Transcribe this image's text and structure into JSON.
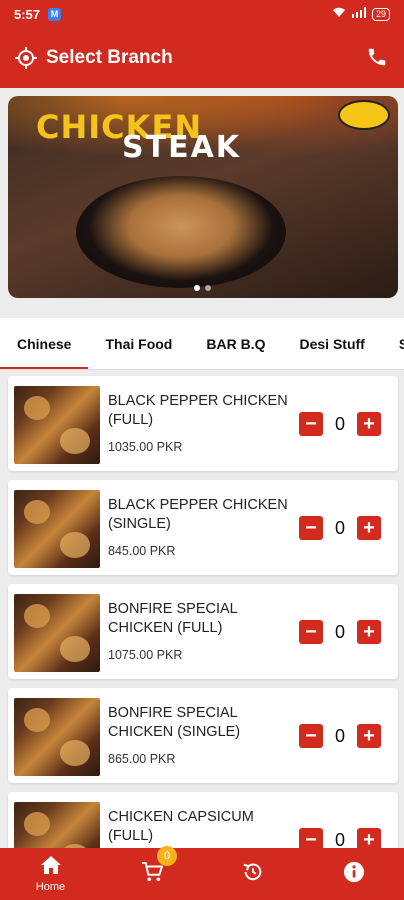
{
  "status_bar": {
    "time": "5:57",
    "notification": "M",
    "battery": "29"
  },
  "app_bar": {
    "title": "Select Branch",
    "location_icon": "location-target-icon",
    "phone_icon": "phone-icon"
  },
  "banner": {
    "line1": "CHICKEN",
    "line2": "STEAK"
  },
  "tabs": [
    {
      "label": "Chinese",
      "active": true
    },
    {
      "label": "Thai Food",
      "active": false
    },
    {
      "label": "BAR B.Q",
      "active": false
    },
    {
      "label": "Desi Stuff",
      "active": false
    },
    {
      "label": "S",
      "active": false
    }
  ],
  "products": [
    {
      "name": "BLACK PEPPER CHICKEN (FULL)",
      "price": "1035.00 PKR",
      "qty": "0"
    },
    {
      "name": "BLACK PEPPER CHICKEN (SINGLE)",
      "price": "845.00 PKR",
      "qty": "0"
    },
    {
      "name": "BONFIRE SPECIAL CHICKEN (FULL)",
      "price": "1075.00 PKR",
      "qty": "0"
    },
    {
      "name": "BONFIRE SPECIAL CHICKEN (SINGLE)",
      "price": "865.00 PKR",
      "qty": "0"
    },
    {
      "name": "CHICKEN CAPSICUM (FULL)",
      "price": "",
      "qty": "0"
    }
  ],
  "controls": {
    "minus": "−",
    "plus": "+"
  },
  "bottom_nav": {
    "home_label": "Home",
    "cart_badge": "0",
    "items": [
      "home-icon",
      "cart-icon",
      "history-icon",
      "info-icon"
    ]
  },
  "colors": {
    "primary": "#d32a1f",
    "badge": "#f7b21b",
    "banner_yellow": "#f6c21c"
  }
}
